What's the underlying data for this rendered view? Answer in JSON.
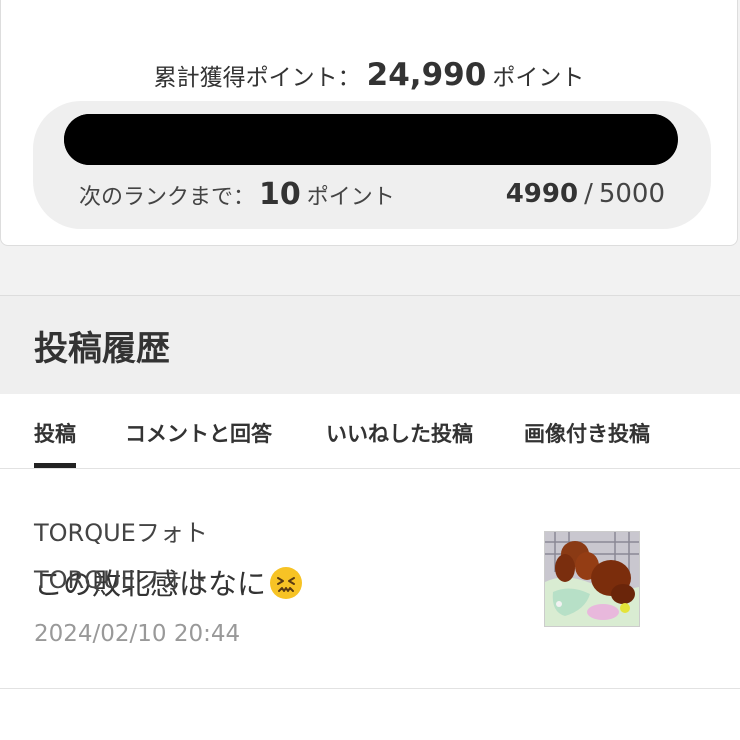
{
  "points": {
    "total_label": "累計獲得ポイント：",
    "total_value": "24,990",
    "total_unit": "ポイント",
    "next_rank_label": "次のランクまで：",
    "next_rank_value": "10",
    "next_rank_unit": "ポイント",
    "progress_current": "4990",
    "progress_separator": "/",
    "progress_max": "5000",
    "progress_fraction": 0.998
  },
  "history": {
    "title": "投稿履歴",
    "tabs": [
      {
        "label": "投稿",
        "active": true
      },
      {
        "label": "コメントと回答",
        "active": false
      },
      {
        "label": "いいねした投稿",
        "active": false
      },
      {
        "label": "画像付き投稿",
        "active": false
      }
    ],
    "posts": [
      {
        "category": "TORQUEフォト",
        "title": "この敗北感はなに",
        "emoji_icon": "confounded-face-icon",
        "date": "2024/02/10 20:44",
        "thumbnail_icon": "dog-photo-thumbnail"
      }
    ],
    "next_post_category": "TORQUEフォト"
  },
  "colors": {
    "progress_bar": "#000000",
    "section_header_bg": "#efefef",
    "active_tab_indicator": "#222222",
    "date_text": "#999999"
  }
}
